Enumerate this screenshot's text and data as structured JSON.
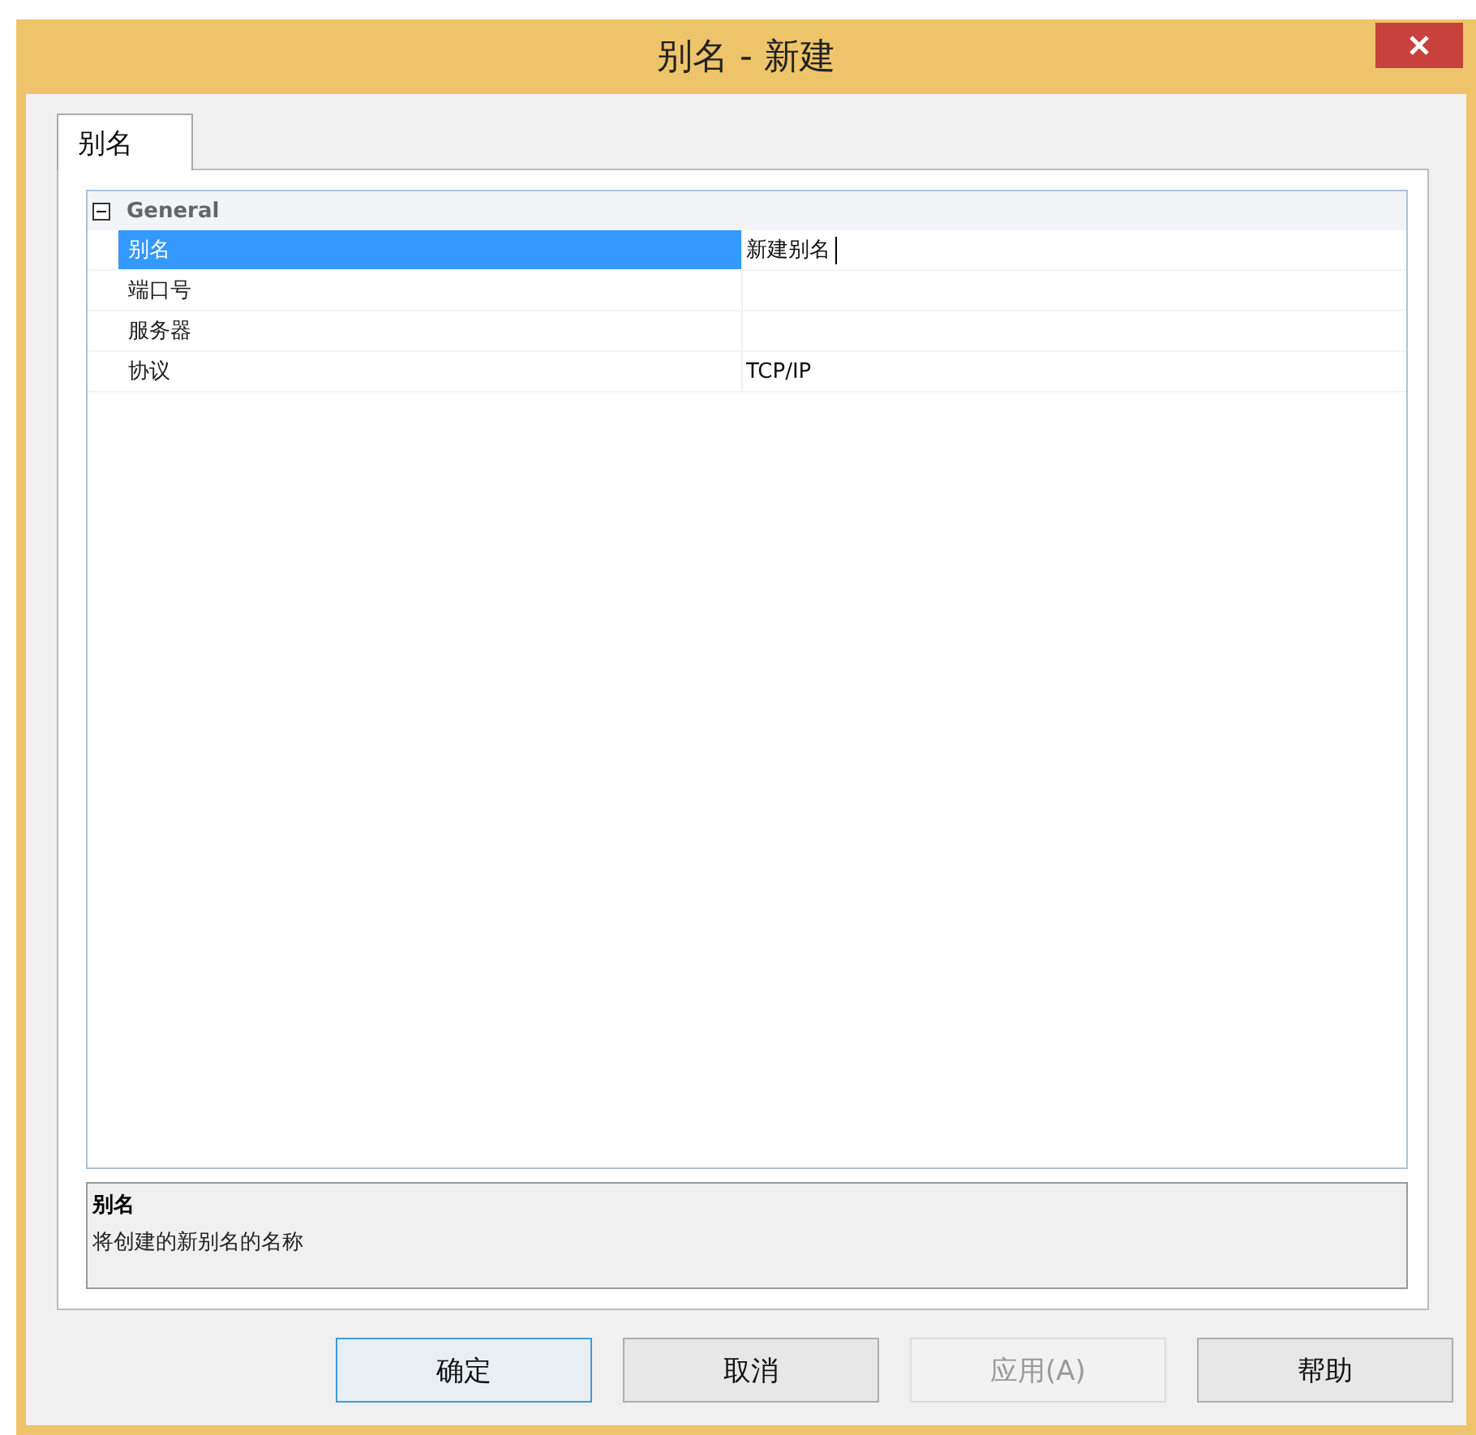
{
  "window": {
    "title": "别名 - 新建"
  },
  "tabs": [
    {
      "label": "别名",
      "selected": true
    }
  ],
  "property_grid": {
    "category": {
      "label": "General",
      "expanded": true
    },
    "properties": [
      {
        "name": "别名",
        "value": "新建别名",
        "selected": true
      },
      {
        "name": "端口号",
        "selected": false
      },
      {
        "name": "服务器",
        "selected": false
      },
      {
        "name": "协议",
        "value": "TCP/IP",
        "selected": false
      }
    ]
  },
  "description": {
    "title": "别名",
    "text": "将创建的新别名的名称"
  },
  "buttons": [
    {
      "label": "确定",
      "default": true,
      "disabled": false
    },
    {
      "label": "取消",
      "default": false,
      "disabled": false
    },
    {
      "label": "应用(A)",
      "default": false,
      "disabled": true
    },
    {
      "label": "帮助",
      "default": false,
      "disabled": false
    }
  ]
}
